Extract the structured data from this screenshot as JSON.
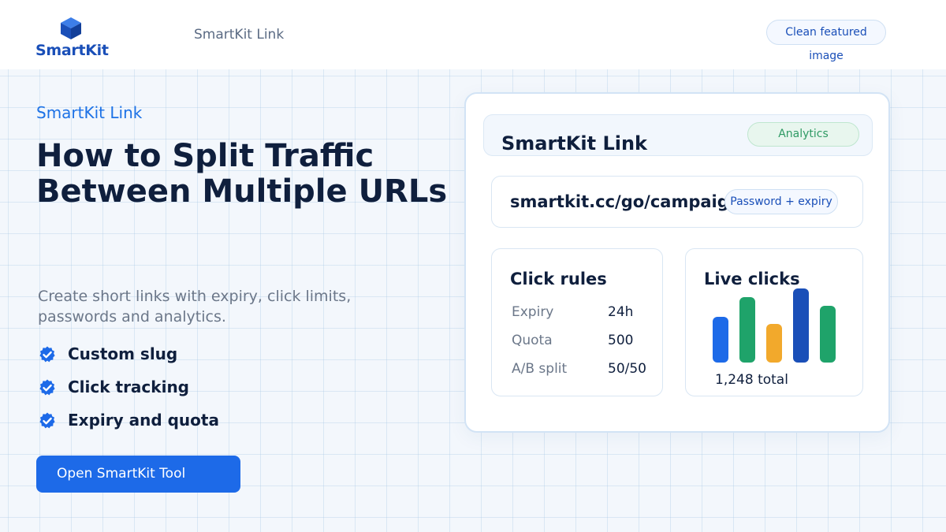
{
  "header": {
    "logo_text": "SmartKit",
    "nav_title": "SmartKit Link",
    "clean_button_label": "Clean featured image"
  },
  "hero": {
    "eyebrow": "SmartKit Link",
    "headline_lines": [
      "How to Split Traffic",
      "Between Multiple URLs"
    ],
    "subtitle": "Create short links with expiry, click limits, passwords and analytics.",
    "features": [
      "Custom slug",
      "Click tracking",
      "Expiry and quota"
    ],
    "cta_label": "Open SmartKit Tool"
  },
  "card": {
    "title": "SmartKit Link",
    "badge": "Analytics",
    "url": "smartkit.cc/go/campaign",
    "url_badge": "Password + expiry",
    "rules": {
      "title": "Click rules",
      "rows": [
        {
          "key": "Expiry",
          "value": "24h"
        },
        {
          "key": "Quota",
          "value": "500"
        },
        {
          "key": "A/B split",
          "value": "50/50"
        }
      ]
    },
    "live_clicks": {
      "title": "Live clicks",
      "total": "1,248 total",
      "bars": [
        {
          "level": 0.62,
          "color": "#1d6ae8"
        },
        {
          "level": 0.88,
          "color": "#1fa36a"
        },
        {
          "level": 0.52,
          "color": "#f2a92c"
        },
        {
          "level": 1.0,
          "color": "#1a4fb8"
        },
        {
          "level": 0.77,
          "color": "#1fa36a"
        }
      ]
    }
  },
  "colors": {
    "brand": "#1a4fb8",
    "accent": "#1d6ae8",
    "success": "#1fa36a"
  },
  "icons": {
    "logo": "cube-icon",
    "feature": "check-circle-icon"
  }
}
